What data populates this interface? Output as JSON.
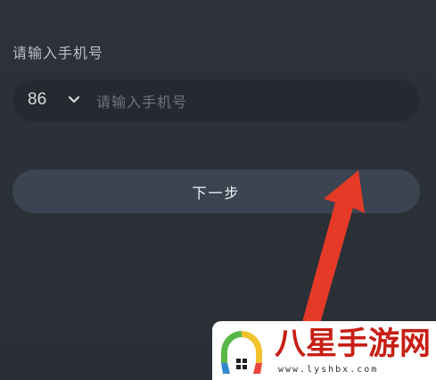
{
  "form": {
    "label": "请输入手机号",
    "country_code": "86",
    "phone_placeholder": "请输入手机号",
    "phone_value": "",
    "next_button_label": "下一步"
  },
  "watermark": {
    "brand": "八星手游网",
    "url": "www.lyshbx.com"
  },
  "icons": {
    "country_dropdown": "chevron-down-icon",
    "annotation": "red-arrow-icon",
    "logo": "app-logo-icon"
  },
  "colors": {
    "background": "#2b3037",
    "input_background": "#252a30",
    "button_background": "#3b4451",
    "arrow": "#e43a27",
    "watermark_text": "#c81e14"
  }
}
